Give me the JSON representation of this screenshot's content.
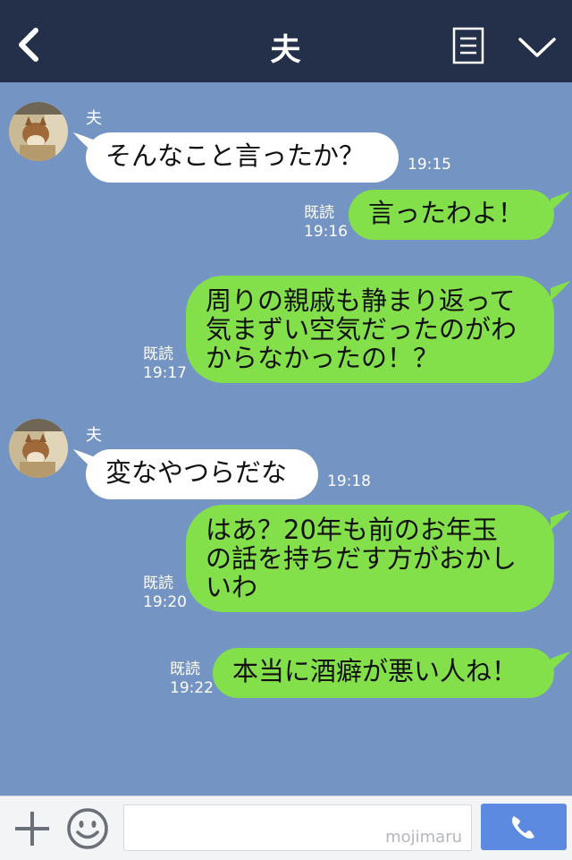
{
  "header": {
    "title": "夫"
  },
  "messages": [
    {
      "sender": "夫",
      "text": "そんなこと言ったか？",
      "time": "19:15"
    },
    {
      "read": "既読",
      "text": "言ったわよ！",
      "time": "19:16"
    },
    {
      "read": "既読",
      "lines": [
        "周りの親戚も静まり返って",
        "気まずい空気だったのがわ",
        "からなかったの！？"
      ],
      "time": "19:17"
    },
    {
      "sender": "夫",
      "text": "変なやつらだな",
      "time": "19:18"
    },
    {
      "read": "既読",
      "lines": [
        "はあ？20年も前のお年玉",
        "の話を持ちだす方がおかし",
        "いわ"
      ],
      "time": "19:20"
    },
    {
      "read": "既読",
      "text": "本当に酒癖が悪い人ね！",
      "time": "19:22"
    }
  ],
  "footer": {
    "watermark": "mojimaru"
  },
  "colors": {
    "header": "#24304a",
    "background": "#7495c3",
    "outgoing": "#84e04a",
    "incoming": "#ffffff",
    "call": "#5b8ae0"
  },
  "icons": [
    "back-chevron-icon",
    "notes-icon",
    "menu-chevron-down-icon",
    "plus-icon",
    "smile-icon",
    "phone-icon"
  ]
}
